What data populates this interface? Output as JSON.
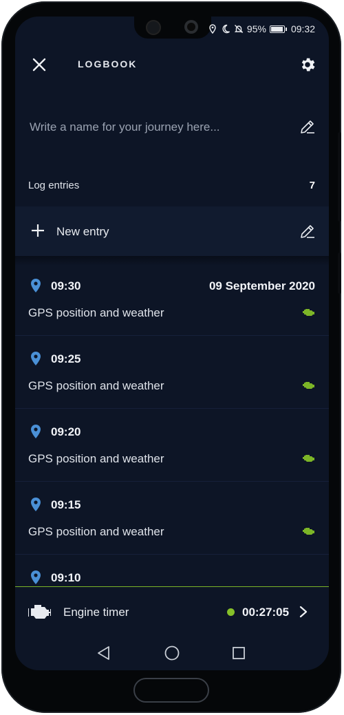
{
  "status_bar": {
    "battery": "95%",
    "time": "09:32",
    "icons": [
      "location-icon",
      "do-not-disturb-moon-icon",
      "bell-off-icon",
      "battery-icon"
    ]
  },
  "header": {
    "title": "LOGBOOK",
    "close_icon": "close-icon",
    "settings_icon": "gear-icon"
  },
  "journey": {
    "placeholder": "Write a name for your journey here...",
    "value": ""
  },
  "log_entries": {
    "label": "Log entries",
    "count": "7"
  },
  "new_entry": {
    "label": "New entry"
  },
  "entries": [
    {
      "time": "09:30",
      "date": "09 September 2020",
      "description": "GPS position and weather"
    },
    {
      "time": "09:25",
      "date": "",
      "description": "GPS position and weather"
    },
    {
      "time": "09:20",
      "date": "",
      "description": "GPS position and weather"
    },
    {
      "time": "09:15",
      "date": "",
      "description": "GPS position and weather"
    },
    {
      "time": "09:10",
      "date": "",
      "description": ""
    }
  ],
  "engine_timer": {
    "label": "Engine timer",
    "value": "00:27:05",
    "status_color": "#86c029"
  },
  "colors": {
    "background": "#0d1526",
    "accent_green": "#7cb527",
    "pin_blue": "#4a90d6"
  }
}
